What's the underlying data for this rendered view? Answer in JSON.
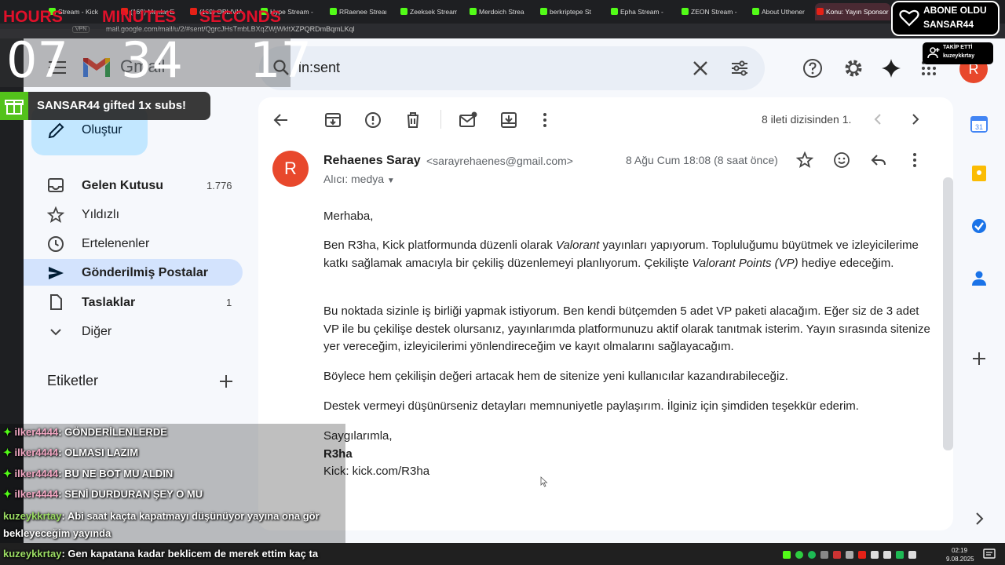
{
  "browser": {
    "tabs": [
      {
        "label": "Stream - Kick",
        "color": "#53fc18"
      },
      {
        "label": "(169) Manlar E",
        "color": "#e62117"
      },
      {
        "label": "(169) OBLIVIA",
        "color": "#e62117"
      },
      {
        "label": "Hype Stream -",
        "color": "#53fc18"
      },
      {
        "label": "RRaenee Stream",
        "color": "#53fc18"
      },
      {
        "label": "Zeeksek Stream",
        "color": "#53fc18"
      },
      {
        "label": "Merdoich Strea",
        "color": "#53fc18"
      },
      {
        "label": "berkriptepe St",
        "color": "#53fc18"
      },
      {
        "label": "Epha Stream -",
        "color": "#53fc18"
      },
      {
        "label": "ZEON Stream -",
        "color": "#53fc18"
      },
      {
        "label": "About Uthener",
        "color": "#53fc18"
      },
      {
        "label": "Konu: Yayın Sponsor",
        "color": "#e62117"
      }
    ],
    "vpn": "VPN",
    "url": "mail.google.com/mail/u/2/#sent/QgrcJHsTmbLBXqZWjWkltXZPQRDmBqmLKql"
  },
  "gmail": {
    "logo_text": "Gmail",
    "search_value": "in:sent",
    "avatar_letter": "R",
    "compose_label": "Oluştur",
    "nav": [
      {
        "label": "Gelen Kutusu",
        "count": "1.776",
        "bold": true
      },
      {
        "label": "Yıldızlı",
        "count": ""
      },
      {
        "label": "Ertelenenler",
        "count": ""
      },
      {
        "label": "Gönderilmiş Postalar",
        "count": "",
        "bold": true
      },
      {
        "label": "Taslaklar",
        "count": "1",
        "bold": true
      },
      {
        "label": "Diğer",
        "count": ""
      }
    ],
    "labels_title": "Etiketler",
    "pager": "8 ileti dizisinden 1.",
    "message": {
      "sender_letter": "R",
      "sender_name": "Rehaenes Saray",
      "sender_email": "<sarayrehaenes@gmail.com>",
      "to": "Alıcı: medya",
      "date": "8 Ağu Cum 18:08 (8 saat önce)",
      "greeting": "Merhaba,",
      "p1_a": "Ben R3ha, Kick platformunda düzenli olarak ",
      "p1_b": "Valorant",
      "p1_c": " yayınları yapıyorum. Topluluğumu büyütmek ve izleyicilerime katkı sağlamak amacıyla bir çekiliş düzenlemeyi planlıyorum. Çekilişte ",
      "p1_d": "Valorant Points (VP)",
      "p1_e": " hediye edeceğim.",
      "p2": "Bu noktada sizinle iş birliği yapmak istiyorum. Ben kendi bütçemden 5 adet VP paketi alacağım. Eğer siz de 3 adet VP ile bu çekilişe destek olursanız, yayınlarımda platformunuzu aktif olarak tanıtmak isterim. Yayın sırasında sitenize yer vereceğim, izleyicilerimi yönlendireceğim ve kayıt olmalarını sağlayacağım.",
      "p3": "Böylece hem çekilişin değeri artacak hem de sitenize yeni kullanıcılar kazandırabileceğiz.",
      "p4": "Destek vermeyi düşünürseniz detayları memnuniyetle paylaşırım. İlginiz için şimdiden teşekkür ederim.",
      "sign1": "Saygılarımla,",
      "sign2": "R3ha",
      "sign3": "Kick: kick.com/R3ha"
    }
  },
  "overlay": {
    "timer_labels": {
      "hours": "HOURS",
      "minutes": "MINUTES",
      "seconds": "SECONDS"
    },
    "timer": {
      "hours": "07",
      "minutes": "34",
      "seconds": "17"
    },
    "gift_text": "SANSAR44 gifted 1x subs!",
    "sub_alert": {
      "line1": "ABONE OLDU",
      "line2": "SANSAR44"
    },
    "follow_alert": {
      "line1": "TAKİP ETTİ",
      "line2": "kuzeykkrtay"
    },
    "chat": [
      {
        "user": "ilker4444",
        "msg": ": GÖNDERİLENLERDE"
      },
      {
        "user": "ilker4444",
        "msg": ": OLMASI LAZIM"
      },
      {
        "user": "ilker4444",
        "msg": ": BU NE BOT MU ALDIN"
      },
      {
        "user": "ilker4444",
        "msg": ": SENİ DURDURAN ŞEY O MU"
      },
      {
        "user": "kuzeykkrtay",
        "msg": ": Abi saat kaçta kapatmayı düşünüyor yayına ona gör"
      },
      {
        "user": "",
        "msg": "bekleyeceğim yayında"
      },
      {
        "user": "kuzeykkrtay",
        "msg": ": Gen kapatana kadar beklicem de merek ettim kaç ta"
      }
    ]
  },
  "taskbar": {
    "time": "02:19",
    "date": "9.08.2025"
  }
}
